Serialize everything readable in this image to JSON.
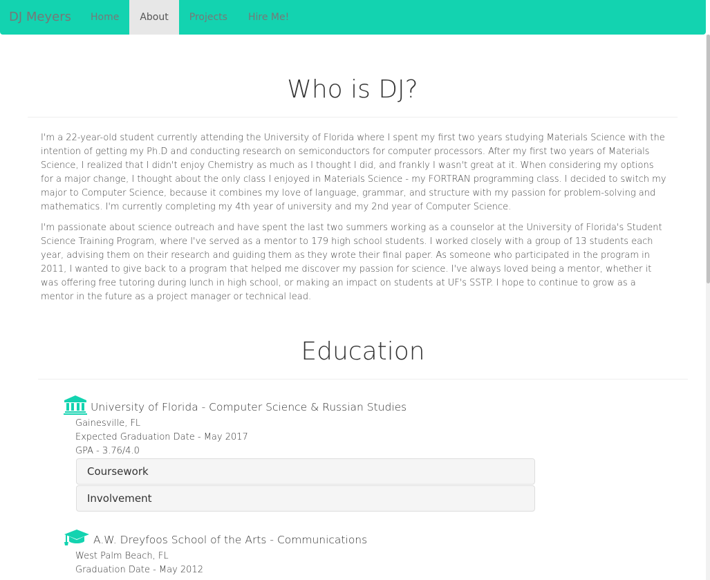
{
  "navbar": {
    "brand": "DJ Meyers",
    "items": [
      {
        "label": "Home"
      },
      {
        "label": "About"
      },
      {
        "label": "Projects"
      },
      {
        "label": "Hire Me!"
      }
    ],
    "accent_color": "#13d3b0"
  },
  "about": {
    "title": "Who is DJ?",
    "paragraphs": [
      "I'm a 22-year-old student currently attending the University of Florida where I spent my first two years studying Materials Science with the intention of getting my Ph.D and conducting research on semiconductors for computer processors. After my first two years of Materials Science, I realized that I didn't enjoy Chemistry as much as I thought I did, and frankly I wasn't great at it. When considering my options for a major change, I thought about the only class I enjoyed in Materials Science - my FORTRAN programming class. I decided to switch my major to Computer Science, because it combines my love of language, grammar, and structure with my passion for problem-solving and mathematics. I'm currently completing my 4th year of university and my 2nd year of Computer Science.",
      "I'm passionate about science outreach and have spent the last two summers working as a counselor at the University of Florida's Student Science Training Program, where I've served as a mentor to 179 high school students. I worked closely with a group of 13 students each year, advising them on their research and guiding them as they wrote their final paper. As someone who participated in the program in 2011, I wanted to give back to a program that helped me discover my passion for science. I've always loved being a mentor, whether it was offering free tutoring during lunch in high school, or making an impact on students at UF's SSTP. I hope to continue to grow as a mentor in the future as a project manager or technical lead."
    ]
  },
  "education": {
    "title": "Education",
    "entries": [
      {
        "icon": "university-icon",
        "name": "University of Florida - Computer Science & Russian Studies",
        "location": "Gainesville, FL",
        "graduation": "Expected Graduation Date - May 2017",
        "gpa": "GPA - 3.76/4.0",
        "panels": [
          {
            "label": "Coursework"
          },
          {
            "label": "Involvement"
          }
        ]
      },
      {
        "icon": "graduation-cap-icon",
        "name": "A.W. Dreyfoos School of the Arts - Communications",
        "location": "West Palm Beach, FL",
        "graduation": "Graduation Date - May 2012"
      }
    ]
  }
}
